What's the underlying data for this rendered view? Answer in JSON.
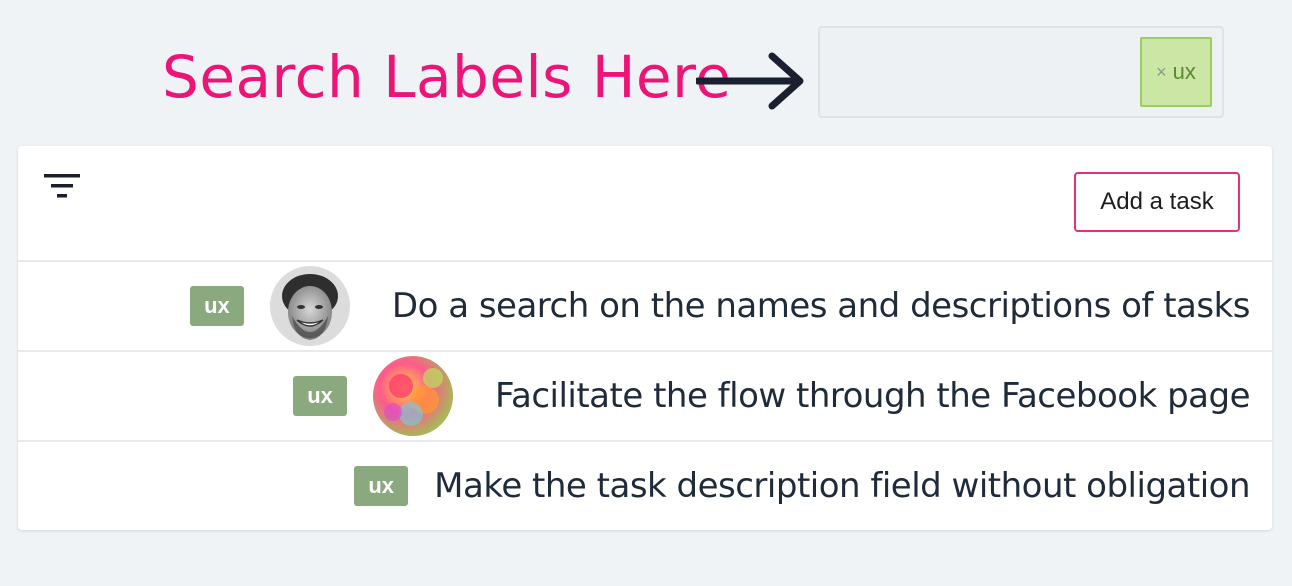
{
  "annotation": {
    "text": "Search Labels Here",
    "color": "#ec1477"
  },
  "search": {
    "tags": [
      {
        "remove_icon": "×",
        "label": "ux"
      }
    ]
  },
  "toolbar": {
    "filter_icon": "filter-icon",
    "add_task_label": "Add a task"
  },
  "tasks": [
    {
      "label": "ux",
      "avatar": "person-avatar",
      "title": "Do a search on the names and descriptions of tasks"
    },
    {
      "label": "ux",
      "avatar": "colorful-avatar",
      "title": "Facilitate the flow through the Facebook page"
    },
    {
      "label": "ux",
      "title": "Make the task description field without obligation"
    }
  ],
  "colors": {
    "accent": "#ec1477",
    "badge": "#8aa97e",
    "tag_bg": "#cce7a5",
    "background": "#f0f3f5"
  }
}
